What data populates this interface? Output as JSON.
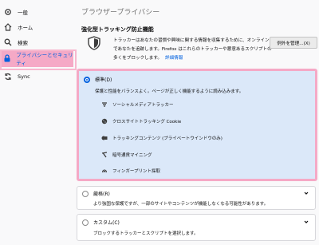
{
  "sidebar": {
    "items": [
      {
        "label": "一般",
        "icon": "gear-icon"
      },
      {
        "label": "ホーム",
        "icon": "home-icon"
      },
      {
        "label": "検索",
        "icon": "search-icon"
      },
      {
        "label": "プライバシーとセキュリティ",
        "icon": "lock-icon"
      },
      {
        "label": "Sync",
        "icon": "sync-icon"
      }
    ]
  },
  "page": {
    "title": "ブラウザープライバシー"
  },
  "etp": {
    "heading": "強化型トラッキング防止機能",
    "description": "トラッカーはあなたの習慣や興味に関する情報を収集するために、オンラインであなたを追跡します。Firefox はこれらのトラッカーや悪意あるスクリプトの多くをブロックします。",
    "learn_more": "詳細情報",
    "exceptions_button": "例外を管理...(X)"
  },
  "options": {
    "standard": {
      "title": "標準(D)",
      "desc": "保護と性能をバランスよく。ページが正しく機能するように読み込みます。",
      "features": [
        {
          "label": "ソーシャルメディアトラッカー",
          "icon": "social-tracker-icon"
        },
        {
          "label": "クロスサイトトラッキング Cookie",
          "icon": "cookie-icon"
        },
        {
          "label": "トラッキングコンテンツ (プライベートウインドウのみ)",
          "icon": "tracking-content-icon"
        },
        {
          "label": "暗号通貨マイニング",
          "icon": "cryptominer-icon"
        },
        {
          "label": "フィンガープリント採取",
          "icon": "fingerprint-icon"
        }
      ]
    },
    "strict": {
      "title": "厳格(R)",
      "desc": "より強固な保護ですが、一部のサイトやコンテンツが機能しなくなる可能性があります。"
    },
    "custom": {
      "title": "カスタム(C)",
      "desc": "ブロックするトラッカーとスクリプトを選択します。"
    }
  },
  "colors": {
    "accent": "#0060df",
    "highlight": "#f5a9c6",
    "selected_card": "#dbe8f9"
  }
}
